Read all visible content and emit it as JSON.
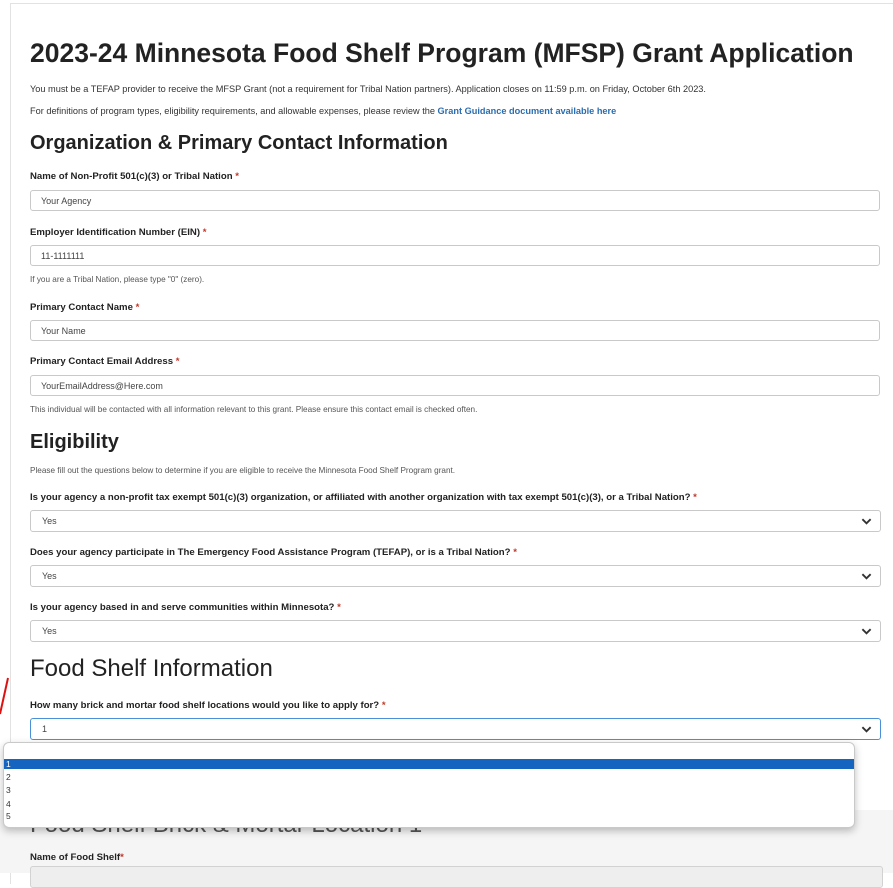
{
  "title": "2023-24 Minnesota Food Shelf Program (MFSP) Grant Application",
  "intro": {
    "line1": "You must be a TEFAP provider to receive the MFSP Grant (not a requirement for Tribal Nation partners). Application closes on 11:59 p.m. on Friday, October 6th 2023.",
    "line2_text": "For definitions of program types, eligibility requirements, and allowable expenses, please review the ",
    "line2_link": "Grant Guidance document available here"
  },
  "org_section": {
    "heading": "Organization & Primary Contact Information",
    "fields": [
      {
        "label": "Name of Non-Profit 501(c)(3) or Tribal Nation",
        "value": "Your Agency"
      },
      {
        "label": "Employer Identification Number (EIN)",
        "value": "11-1111111",
        "help": "If you are a Tribal Nation, please type \"0\" (zero)."
      },
      {
        "label": "Primary Contact Name",
        "value": "Your Name"
      },
      {
        "label": "Primary Contact Email Address",
        "value": "YourEmailAddress@Here.com",
        "help": "This individual will be contacted with all information relevant to this grant. Please ensure this contact email is checked often."
      }
    ]
  },
  "eligibility": {
    "heading": "Eligibility",
    "intro": "Please fill out the questions below to determine if you are eligible to receive the Minnesota Food Shelf Program grant.",
    "questions": [
      {
        "label": "Is your agency a non-profit tax exempt 501(c)(3) organization, or affiliated with another organization with tax exempt 501(c)(3), or a Tribal Nation?",
        "value": "Yes"
      },
      {
        "label": "Does your agency participate in The Emergency Food Assistance Program (TEFAP), or is a Tribal Nation?",
        "value": "Yes"
      },
      {
        "label": "Is your agency based in and serve communities within Minnesota?",
        "value": "Yes"
      }
    ]
  },
  "food_shelf": {
    "heading": "Food Shelf Information",
    "question": "How many brick and mortar food shelf locations would you like to apply for?",
    "value": "1",
    "options": [
      "1",
      "2",
      "3",
      "4",
      "5"
    ],
    "selected_index": 0
  },
  "location_section": {
    "heading": "Food Shelf Brick & Mortar Location 1",
    "field_label": "Name of Food Shelf"
  },
  "required_mark": "*",
  "colors": {
    "required": "#c0392b",
    "link": "#2a6db0",
    "selected_option": "#1565c0",
    "focus_border": "#4a90d9"
  }
}
